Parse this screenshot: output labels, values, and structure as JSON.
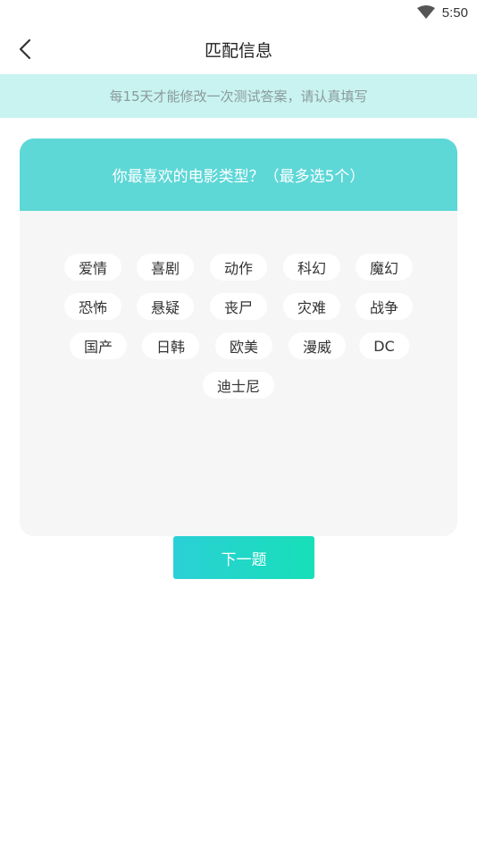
{
  "status_bar": {
    "time": "5:50",
    "wifi_icon": "wifi-icon"
  },
  "nav": {
    "back_icon": "chevron-left-icon",
    "title": "匹配信息"
  },
  "notice": {
    "text": "每15天才能修改一次测试答案，请认真填写"
  },
  "question": {
    "title": "你最喜欢的电影类型？（最多选5个）",
    "options": [
      "爱情",
      "喜剧",
      "动作",
      "科幻",
      "魔幻",
      "恐怖",
      "悬疑",
      "丧尸",
      "灾难",
      "战争",
      "国产",
      "日韩",
      "欧美",
      "漫威",
      "DC",
      "迪士尼"
    ]
  },
  "actions": {
    "next_label": "下一题"
  },
  "colors": {
    "notice_bg": "#c9f3f1",
    "header_bg": "#5ed7d7",
    "button_gradient_start": "#2bd0d6",
    "button_gradient_end": "#17dfb8"
  }
}
